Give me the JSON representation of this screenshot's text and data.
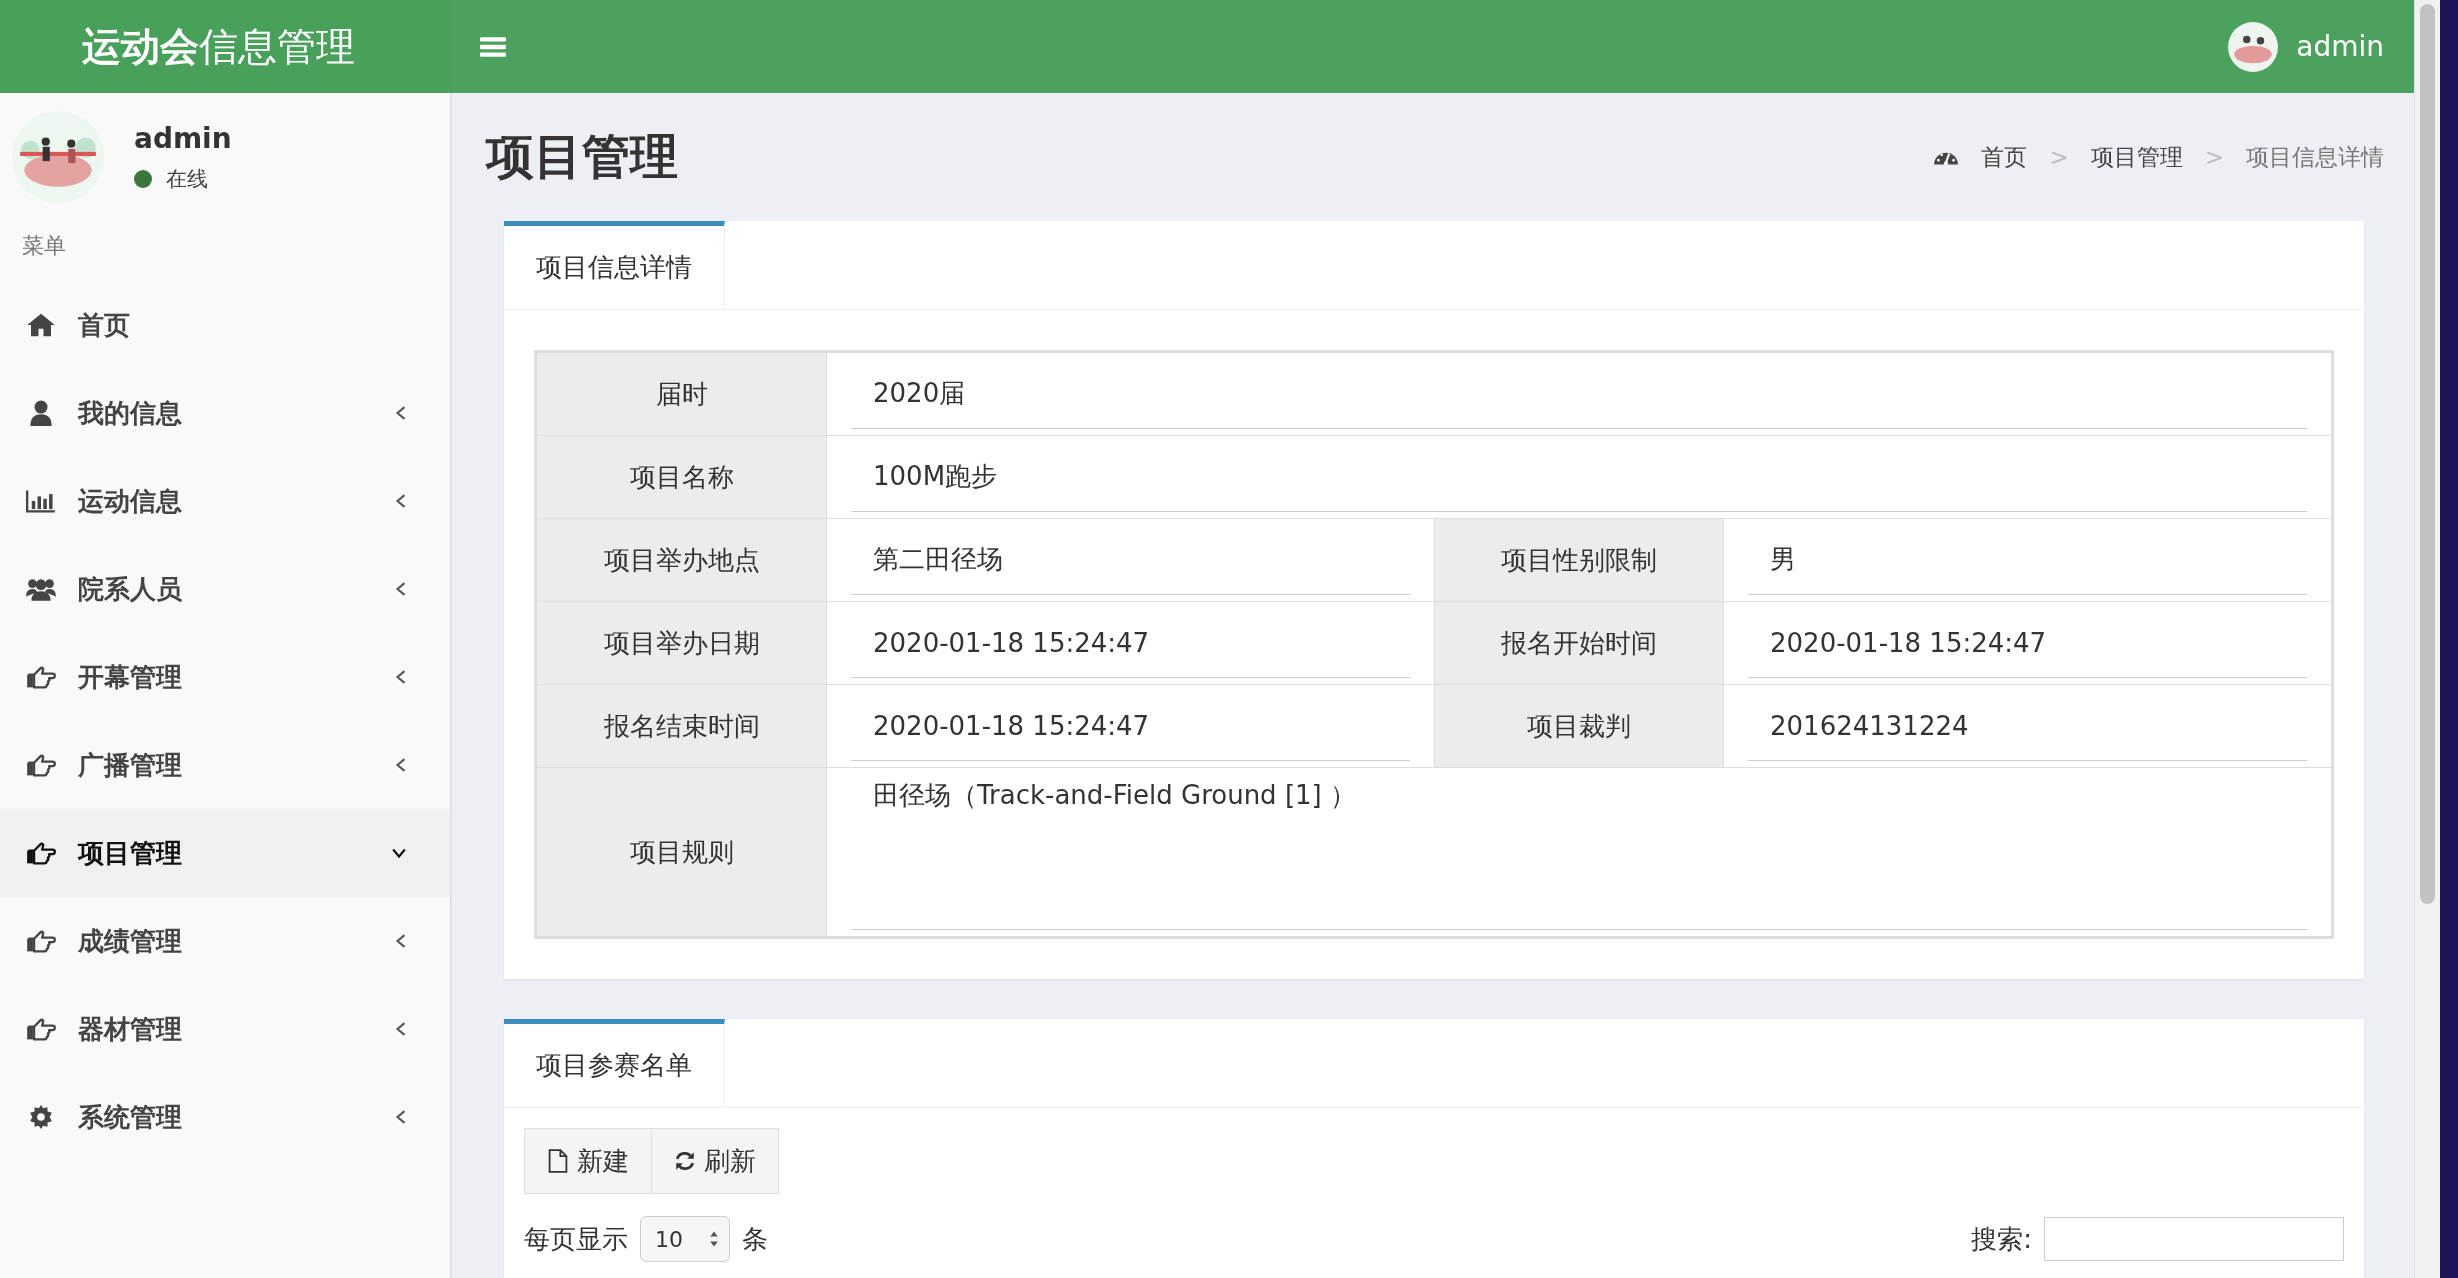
{
  "header": {
    "logo": "**运动会**信息管理",
    "user": "admin"
  },
  "user_panel": {
    "name": "admin",
    "status": "在线",
    "online": true
  },
  "sidebar": {
    "heading": "菜单",
    "items": [
      {
        "label": "首页",
        "kind": "home",
        "selected": false
      },
      {
        "label": "我的信息",
        "kind": "user",
        "selected": false,
        "expanded": false
      },
      {
        "label": "运动信息",
        "kind": "chart",
        "selected": false,
        "expanded": false
      },
      {
        "label": "院系人员",
        "kind": "users",
        "selected": false,
        "expanded": false
      },
      {
        "label": "开幕管理",
        "kind": "hand",
        "selected": false,
        "expanded": false
      },
      {
        "label": "广播管理",
        "kind": "hand",
        "selected": false,
        "expanded": false
      },
      {
        "label": "项目管理",
        "kind": "hand",
        "selected": true,
        "expanded": true
      },
      {
        "label": "成绩管理",
        "kind": "hand",
        "selected": false,
        "expanded": false
      },
      {
        "label": "器材管理",
        "kind": "hand",
        "selected": false,
        "expanded": false
      },
      {
        "label": "系统管理",
        "kind": "gear",
        "selected": false,
        "expanded": false
      }
    ]
  },
  "page": {
    "title": "项目管理",
    "breadcrumb": {
      "separator": ">",
      "items": [
        "首页",
        "项目管理",
        "项目信息详情"
      ]
    }
  },
  "detail_panel": {
    "tabs": [
      {
        "label": "项目信息详情",
        "selected": true
      }
    ],
    "rows": [
      {
        "kind": "line",
        "fields": [
          {
            "label": "届时",
            "value": "2020届"
          }
        ]
      },
      {
        "kind": "line",
        "fields": [
          {
            "label": "项目名称",
            "value": "100M跑步"
          }
        ]
      },
      {
        "kind": "line",
        "fields": [
          {
            "label": "项目举办地点",
            "value": "第二田径场"
          },
          {
            "label": "项目性别限制",
            "value": "男"
          }
        ]
      },
      {
        "kind": "line",
        "fields": [
          {
            "label": "项目举办日期",
            "value": "2020-01-18 15:24:47"
          },
          {
            "label": "报名开始时间",
            "value": "2020-01-18 15:24:47"
          }
        ]
      },
      {
        "kind": "line",
        "fields": [
          {
            "label": "报名结束时间",
            "value": "2020-01-18 15:24:47"
          },
          {
            "label": "项目裁判",
            "value": "201624131224"
          }
        ]
      },
      {
        "kind": "textarea",
        "fields": [
          {
            "label": "项目规则",
            "value": "田径场（Track-and-Field Ground [1] ）"
          }
        ]
      }
    ]
  },
  "entrants_panel": {
    "tabs": [
      {
        "label": "项目参赛名单",
        "selected": true
      }
    ],
    "buttons": [
      {
        "label": "新建",
        "kind": "new"
      },
      {
        "label": "刷新",
        "kind": "refresh"
      }
    ],
    "page_length": {
      "prefix": "每页显示",
      "value": "10",
      "suffix": "条"
    },
    "search": {
      "label": "搜索:"
    }
  }
}
